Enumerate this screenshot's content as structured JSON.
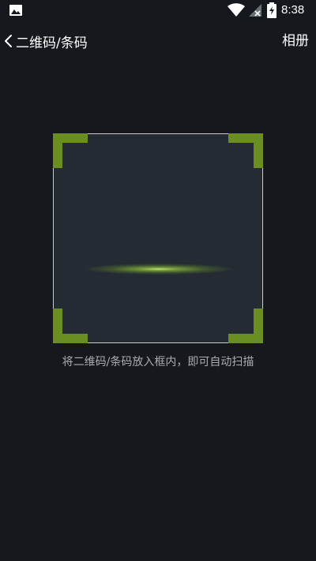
{
  "status_bar": {
    "time": "8:38",
    "icons": [
      "gallery-icon",
      "wifi-icon",
      "no-sim-signal-icon",
      "battery-icon"
    ]
  },
  "header": {
    "back_icon": "chevron-left-icon",
    "title": "二维码/条码",
    "album_label": "相册"
  },
  "scanner": {
    "corner_color": "#6b8e23",
    "scan_line_color": "#a4d64c",
    "hint": "将二维码/条码放入框内，即可自动扫描"
  },
  "colors": {
    "background": "#15181c",
    "frame_fill": "#252b33",
    "text_primary": "#ffffff",
    "text_hint": "#a9adb1"
  }
}
